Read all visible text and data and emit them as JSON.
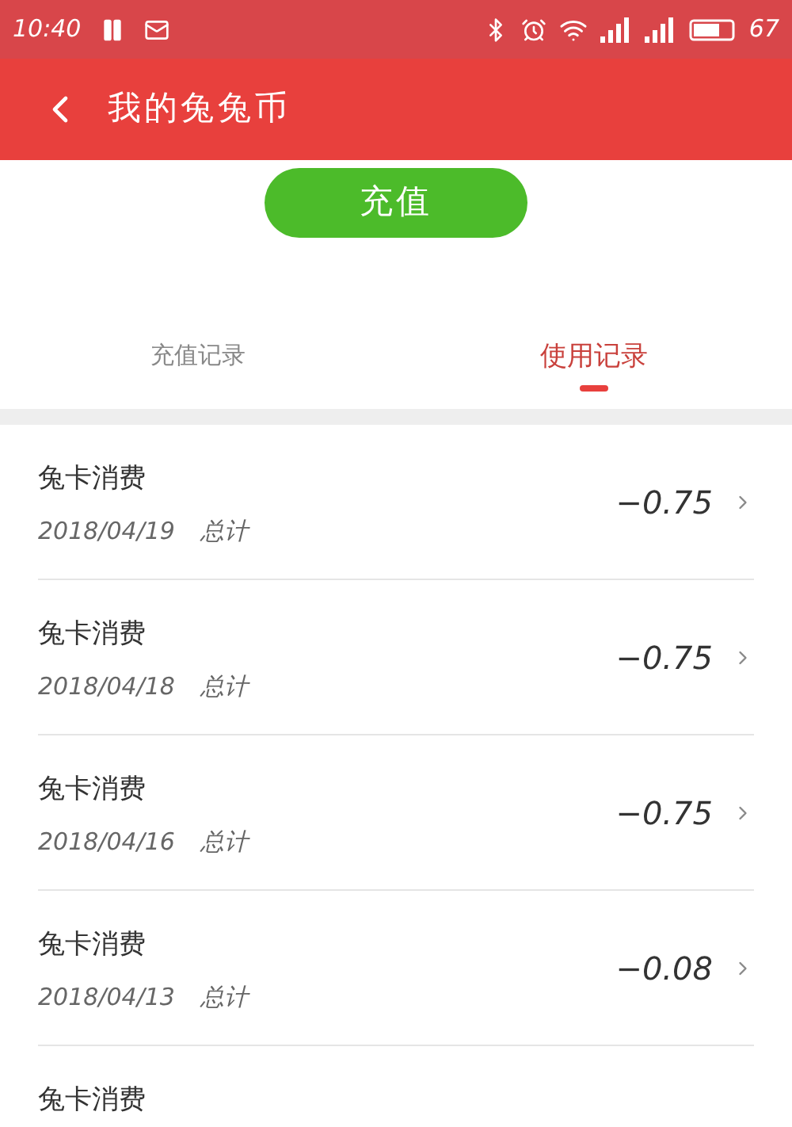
{
  "status_bar": {
    "time": "10:40",
    "battery": "67"
  },
  "header": {
    "title": "我的兔兔币"
  },
  "recharge_button": "充值",
  "tabs": [
    {
      "label": "充值记录",
      "selected": false
    },
    {
      "label": "使用记录",
      "selected": true
    }
  ],
  "records": [
    {
      "title": "兔卡消费",
      "date": "2018/04/19",
      "total_label": "总计",
      "amount": "−0.75"
    },
    {
      "title": "兔卡消费",
      "date": "2018/04/18",
      "total_label": "总计",
      "amount": "−0.75"
    },
    {
      "title": "兔卡消费",
      "date": "2018/04/16",
      "total_label": "总计",
      "amount": "−0.75"
    },
    {
      "title": "兔卡消费",
      "date": "2018/04/13",
      "total_label": "总计",
      "amount": "−0.08"
    },
    {
      "title": "兔卡消费"
    }
  ]
}
